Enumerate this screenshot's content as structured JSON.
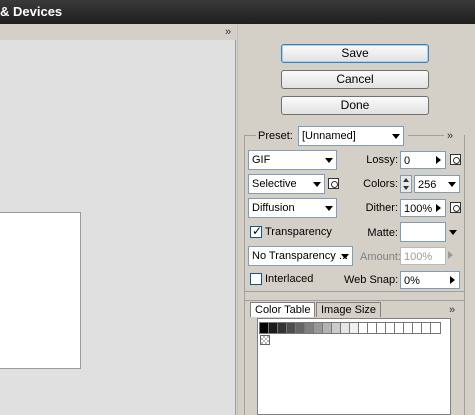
{
  "window": {
    "title": "& Devices"
  },
  "buttons": {
    "save": "Save",
    "cancel": "Cancel",
    "done": "Done"
  },
  "settings": {
    "preset_label": "Preset:",
    "preset_value": "[Unnamed]",
    "format_value": "GIF",
    "lossy_label": "Lossy:",
    "lossy_value": "0",
    "reduction_value": "Selective",
    "colors_label": "Colors:",
    "colors_value": "256",
    "dither_algo_value": "Diffusion",
    "dither_label": "Dither:",
    "dither_value": "100%",
    "transparency_label": "Transparency",
    "transparency_checked": true,
    "matte_label": "Matte:",
    "matte_value": "",
    "transparency_dither_value": "No Transparency ...",
    "amount_label": "Amount:",
    "amount_value": "100%",
    "interlaced_label": "Interlaced",
    "interlaced_checked": false,
    "web_snap_label": "Web Snap:",
    "web_snap_value": "0%"
  },
  "tabs": [
    {
      "label": "Color Table",
      "active": true
    },
    {
      "label": "Image Size",
      "active": false
    }
  ],
  "panel_expand_glyph": "»",
  "icons": [
    "expand-icon",
    "dropdown-arrow-icon",
    "flyout-arrow-icon",
    "optimize-icon",
    "transparent-swatch-icon"
  ]
}
